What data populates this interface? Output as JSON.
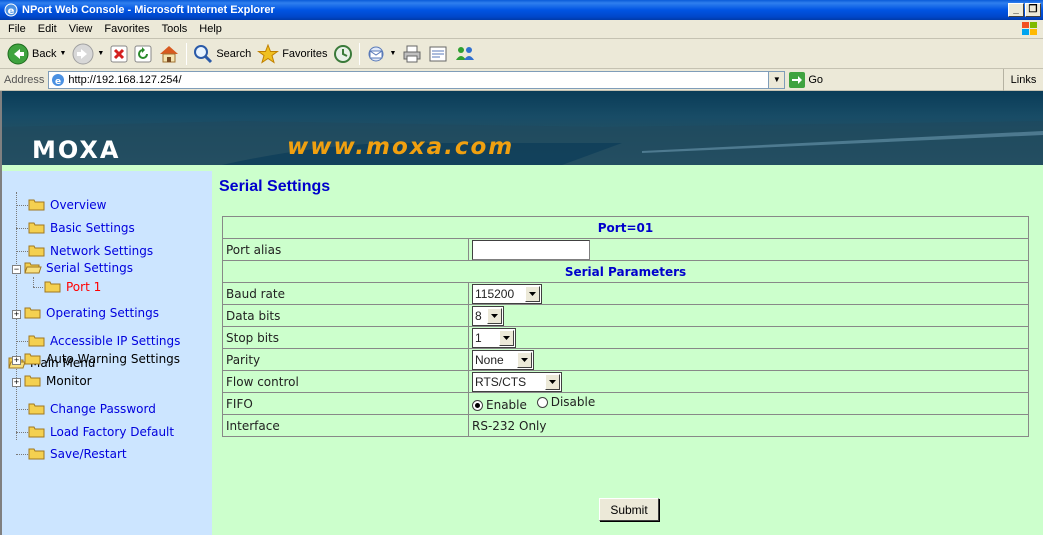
{
  "window": {
    "title": "NPort Web Console - Microsoft Internet Explorer"
  },
  "menubar": {
    "items": [
      "File",
      "Edit",
      "View",
      "Favorites",
      "Tools",
      "Help"
    ]
  },
  "toolbar": {
    "back": "Back",
    "search": "Search",
    "favorites": "Favorites"
  },
  "addressbar": {
    "label": "Address",
    "url": "http://192.168.127.254/",
    "go": "Go",
    "links": "Links"
  },
  "banner": {
    "logo": "MOXA",
    "site": "www.moxa.com"
  },
  "sidebar": {
    "root": "Main Menu",
    "items": [
      {
        "label": "Overview"
      },
      {
        "label": "Basic Settings"
      },
      {
        "label": "Network Settings"
      },
      {
        "label": "Serial Settings"
      },
      {
        "label": "Port 1"
      },
      {
        "label": "Operating Settings"
      },
      {
        "label": "Accessible IP Settings"
      },
      {
        "label": "Auto Warning Settings"
      },
      {
        "label": "Monitor"
      },
      {
        "label": "Change Password"
      },
      {
        "label": "Load Factory Default"
      },
      {
        "label": "Save/Restart"
      }
    ]
  },
  "main": {
    "title": "Serial Settings",
    "port_header": "Port=01",
    "port_alias_label": "Port alias",
    "port_alias_value": "",
    "params_header": "Serial Parameters",
    "baud_rate": {
      "label": "Baud rate",
      "value": "115200"
    },
    "data_bits": {
      "label": "Data bits",
      "value": "8"
    },
    "stop_bits": {
      "label": "Stop bits",
      "value": "1"
    },
    "parity": {
      "label": "Parity",
      "value": "None"
    },
    "flow_control": {
      "label": "Flow control",
      "value": "RTS/CTS"
    },
    "fifo": {
      "label": "FIFO",
      "options": [
        "Enable",
        "Disable"
      ],
      "selected": "Enable"
    },
    "interface": {
      "label": "Interface",
      "value": "RS-232 Only"
    },
    "submit": "Submit"
  }
}
